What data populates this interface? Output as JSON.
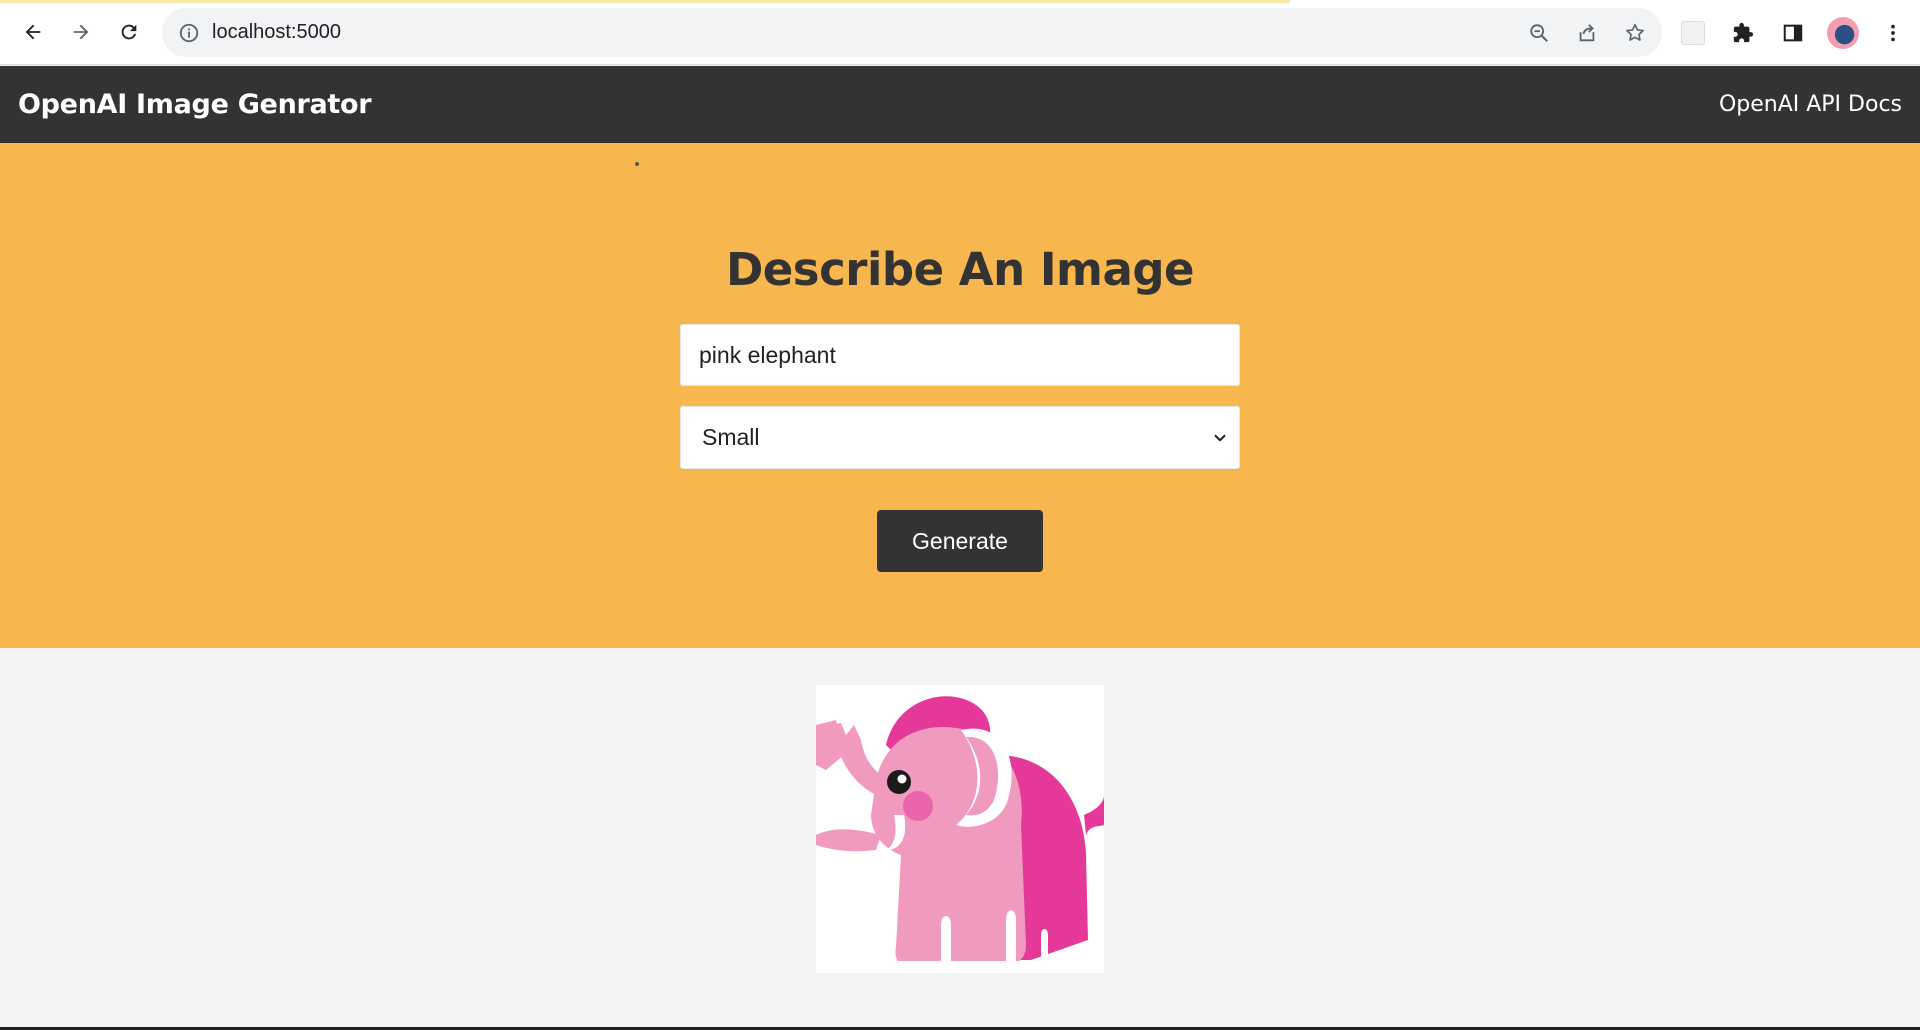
{
  "browser": {
    "url": "localhost:5000",
    "icons": [
      "back-arrow-icon",
      "forward-arrow-icon",
      "reload-icon",
      "info-icon",
      "zoom-out-icon",
      "share-icon",
      "star-icon",
      "extension-puzzle-icon",
      "side-panel-icon",
      "kebab-menu-icon"
    ]
  },
  "navbar": {
    "brand": "OpenAI Image Genrator",
    "docs_link": "OpenAI API Docs"
  },
  "form": {
    "heading": "Describe An Image",
    "prompt_value": "pink elephant",
    "size_selected": "Small",
    "generate_label": "Generate"
  },
  "colors": {
    "navbar_bg": "#333333",
    "showcase_bg": "#f8b64e",
    "page_bg": "#f4f4f4",
    "button_bg": "#333333",
    "elephant_light": "#f09ac0",
    "elephant_dark": "#e5399a"
  },
  "result_image": {
    "subject": "pink elephant illustration"
  }
}
